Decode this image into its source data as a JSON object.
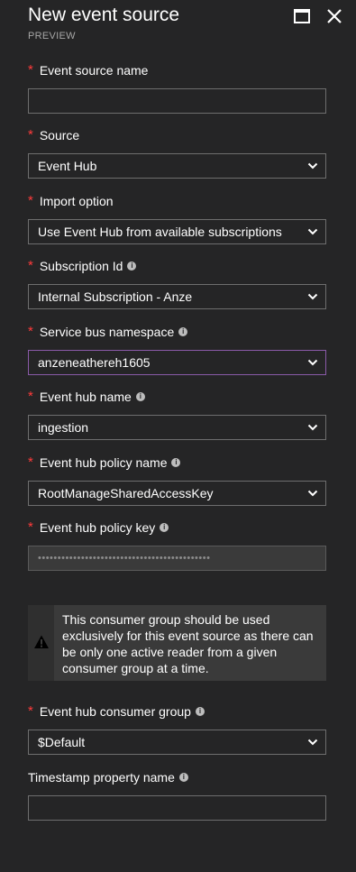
{
  "header": {
    "title": "New event source",
    "subtitle": "PREVIEW"
  },
  "form": {
    "event_source_name": {
      "label": "Event source name",
      "required": true,
      "value": ""
    },
    "source": {
      "label": "Source",
      "required": true,
      "value": "Event Hub"
    },
    "import_option": {
      "label": "Import option",
      "required": true,
      "value": "Use Event Hub from available subscriptions"
    },
    "subscription_id": {
      "label": "Subscription Id",
      "required": true,
      "info": true,
      "value": "Internal Subscription - Anze"
    },
    "service_bus_namespace": {
      "label": "Service bus namespace",
      "required": true,
      "info": true,
      "value": "anzeneathereh1605"
    },
    "event_hub_name": {
      "label": "Event hub name",
      "required": true,
      "info": true,
      "value": "ingestion"
    },
    "event_hub_policy_name": {
      "label": "Event hub policy name",
      "required": true,
      "info": true,
      "value": "RootManageSharedAccessKey"
    },
    "event_hub_policy_key": {
      "label": "Event hub policy key",
      "required": true,
      "info": true,
      "value": "••••••••••••••••••••••••••••••••••••••••••••"
    },
    "warning": {
      "text": "This consumer group should be used exclusively for this event source as there can be only one active reader from a given consumer group at a time."
    },
    "event_hub_consumer_group": {
      "label": "Event hub consumer group",
      "required": true,
      "info": true,
      "value": "$Default"
    },
    "timestamp_property_name": {
      "label": "Timestamp property name",
      "required": false,
      "info": true,
      "value": ""
    }
  },
  "icons": {
    "maximize": "maximize-icon",
    "close": "close-icon",
    "info": "info-icon",
    "chevron": "chevron-down-icon",
    "warning": "warning-icon"
  },
  "colors": {
    "background": "#252526",
    "required": "#ff3b3b",
    "focus_border": "#8a5aa8",
    "field_border": "#6e6e6e",
    "warning_bg": "#3a3a3a"
  }
}
